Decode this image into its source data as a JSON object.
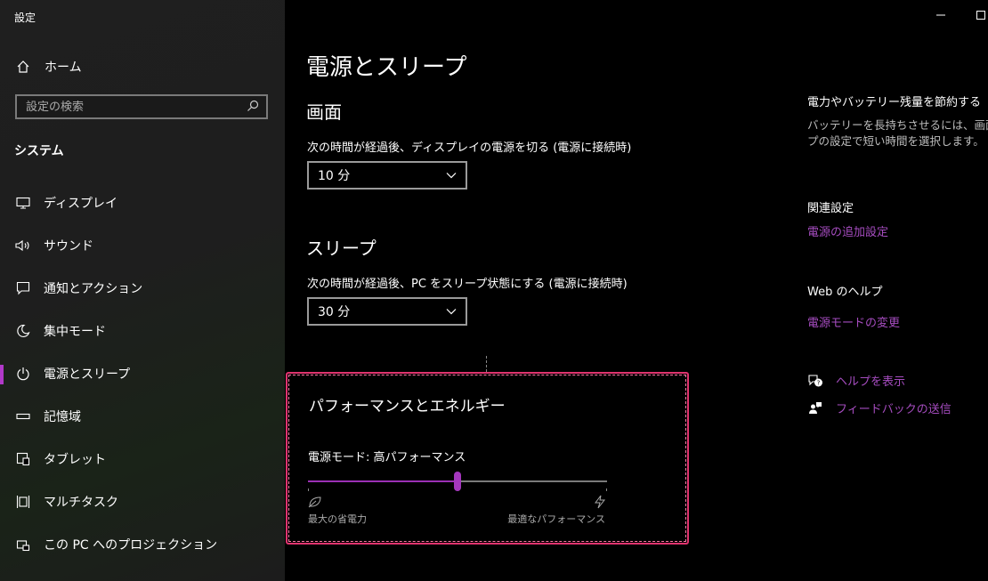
{
  "window": {
    "title": "設定"
  },
  "sidebar": {
    "home_label": "ホーム",
    "search_placeholder": "設定の検索",
    "section_label": "システム",
    "items": [
      {
        "label": "ディスプレイ",
        "icon": "monitor-icon"
      },
      {
        "label": "サウンド",
        "icon": "speaker-icon"
      },
      {
        "label": "通知とアクション",
        "icon": "message-icon"
      },
      {
        "label": "集中モード",
        "icon": "moon-icon"
      },
      {
        "label": "電源とスリープ",
        "icon": "power-icon",
        "active": true
      },
      {
        "label": "記憶域",
        "icon": "storage-icon"
      },
      {
        "label": "タブレット",
        "icon": "tablet-icon"
      },
      {
        "label": "マルチタスク",
        "icon": "multitask-icon"
      },
      {
        "label": "この PC へのプロジェクション",
        "icon": "projection-icon"
      }
    ]
  },
  "main": {
    "title": "電源とスリープ",
    "screen": {
      "heading": "画面",
      "description": "次の時間が経過後、ディスプレイの電源を切る (電源に接続時)",
      "value": "10 分"
    },
    "sleep": {
      "heading": "スリープ",
      "description": "次の時間が経過後、PC をスリープ状態にする (電源に接続時)",
      "value": "30 分"
    },
    "performance": {
      "heading": "パフォーマンスとエネルギー",
      "mode_label": "電源モード: 高パフォーマンス",
      "slider_value": 0.5,
      "left_label": "最大の省電力",
      "right_label": "最適なパフォーマンス"
    }
  },
  "right": {
    "save_heading": "電力やバッテリー残量を節約する",
    "save_text_1": "バッテリーを長持ちさせるには、画面と",
    "save_text_2": "プの設定で短い時間を選択します。",
    "related_heading": "関連設定",
    "related_link": "電源の追加設定",
    "web_help_heading": "Web のヘルプ",
    "web_help_link": "電源モードの変更",
    "help_link": "ヘルプを表示",
    "feedback_link": "フィードバックの送信"
  },
  "colors": {
    "accent": "#a437bd",
    "link": "#a54cbf",
    "focus_border": "#e0336e"
  }
}
